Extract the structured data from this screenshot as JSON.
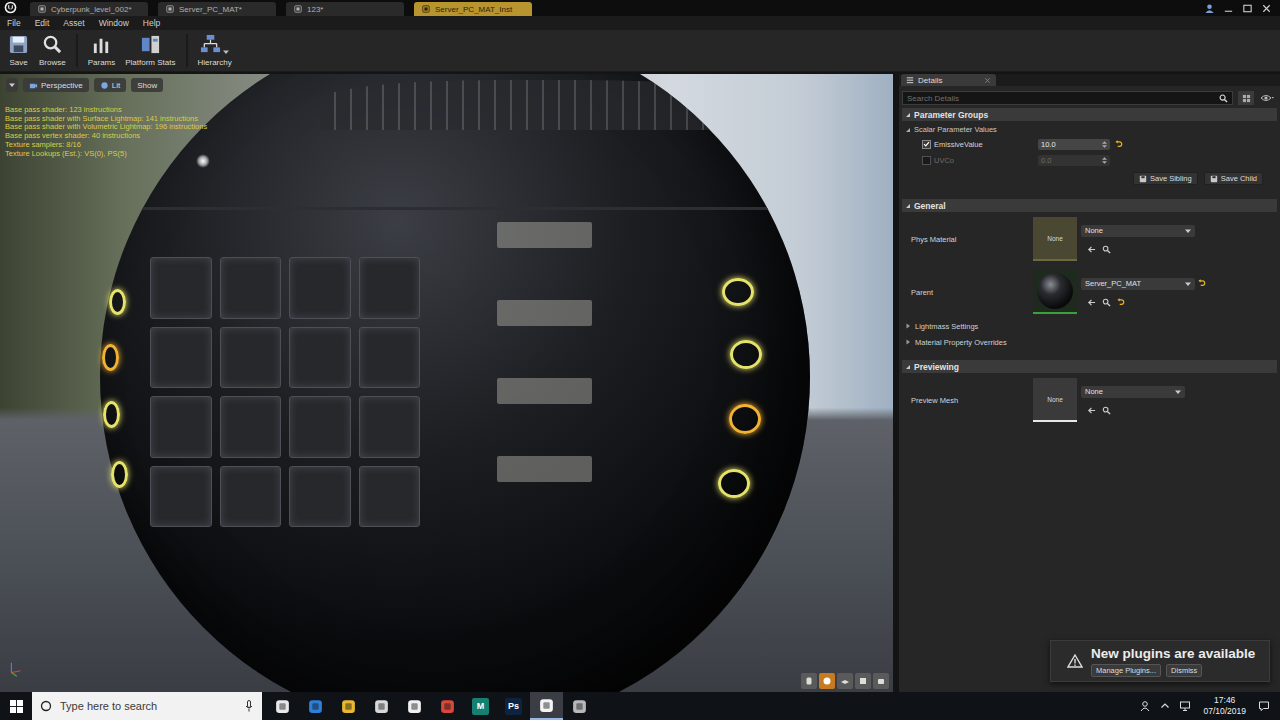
{
  "app_tabs": [
    {
      "label": "Cyberpunk_level_002*",
      "selected": false
    },
    {
      "label": "Server_PC_MAT*",
      "selected": false
    },
    {
      "label": "123*",
      "selected": false
    },
    {
      "label": "Server_PC_MAT_Inst",
      "selected": true
    }
  ],
  "menu": [
    "File",
    "Edit",
    "Asset",
    "Window",
    "Help"
  ],
  "toolbar": [
    {
      "label": "Save",
      "separator_before": false,
      "dropdown": false
    },
    {
      "label": "Browse",
      "separator_before": false,
      "dropdown": false
    },
    {
      "label": "Params",
      "separator_before": true,
      "dropdown": false
    },
    {
      "label": "Platform Stats",
      "separator_before": false,
      "dropdown": false
    },
    {
      "label": "Hierarchy",
      "separator_before": true,
      "dropdown": true
    }
  ],
  "viewport": {
    "buttons": [
      {
        "label": "Perspective"
      },
      {
        "label": "Lit"
      },
      {
        "label": "Show"
      }
    ],
    "stats": [
      "Base pass shader: 123 instructions",
      "Base pass shader with Surface Lightmap: 141 instructions",
      "Base pass shader with Volumetric Lightmap: 196 instructions",
      "Base pass vertex shader: 40 instructions",
      "Texture samplers: 8/16",
      "Texture Lookups (Est.): VS(0), PS(5)"
    ],
    "view_modes": [
      {
        "selected": false
      },
      {
        "selected": true
      },
      {
        "selected": false
      },
      {
        "selected": false
      },
      {
        "selected": false
      }
    ]
  },
  "details": {
    "tab": "Details",
    "search_placeholder": "Search Details",
    "parameter_groups": {
      "title": "Parameter Groups",
      "subtitle": "Scalar Parameter Values",
      "params": [
        {
          "name": "EmissiveValue",
          "checked": true,
          "value": "10.0",
          "disabled": false,
          "modified": true
        },
        {
          "name": "UVCo",
          "checked": false,
          "value": "0.0",
          "disabled": true,
          "modified": false
        }
      ],
      "buttons": [
        "Save Sibling",
        "Save Child"
      ]
    },
    "general": {
      "title": "General",
      "rows": [
        {
          "label": "Phys Material",
          "thumb": {
            "kind": "physmat",
            "label": "None"
          },
          "value": "None",
          "modified": false
        },
        {
          "label": "Parent",
          "thumb": {
            "kind": "material",
            "label": ""
          },
          "value": "Server_PC_MAT",
          "modified": true
        }
      ],
      "collapsed": [
        "Lightmass Settings",
        "Material Property Overrides"
      ]
    },
    "previewing": {
      "title": "Previewing",
      "rows": [
        {
          "label": "Preview Mesh",
          "thumb": {
            "kind": "mesh",
            "label": "None"
          },
          "value": "None",
          "modified": false
        }
      ]
    }
  },
  "notification": {
    "text": "New plugins are available",
    "buttons": [
      "Manage Plugins...",
      "Dismiss"
    ]
  },
  "taskbar": {
    "search_placeholder": "Type here to search",
    "apps": [
      {
        "glyph": "",
        "color": "#e8e8e8",
        "selected": false
      },
      {
        "glyph": "",
        "color": "#2f7fd8",
        "selected": false
      },
      {
        "glyph": "",
        "color": "#e8b830",
        "selected": false
      },
      {
        "glyph": "",
        "color": "#d8d8d8",
        "selected": false
      },
      {
        "glyph": "",
        "color": "#f0f0f0",
        "selected": false
      },
      {
        "glyph": "",
        "color": "#d9483b",
        "selected": false
      },
      {
        "glyph": "M",
        "color": "#15806f",
        "selected": false
      },
      {
        "glyph": "Ps",
        "color": "#0d2340",
        "selected": false
      },
      {
        "glyph": "",
        "color": "#f4f4f4",
        "selected": true
      },
      {
        "glyph": "",
        "color": "#b8b8b8",
        "selected": false
      }
    ],
    "time": "17:46",
    "date": "07/10/2019"
  }
}
